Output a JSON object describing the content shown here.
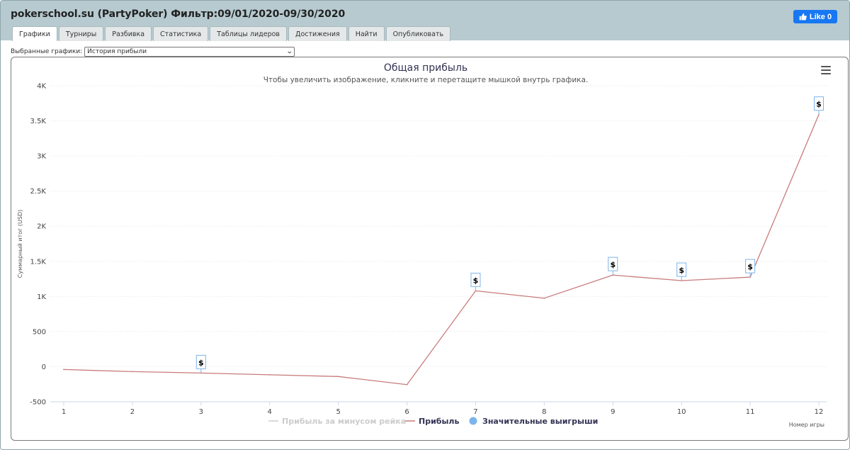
{
  "window": {
    "title": "pokerschool.su (PartyPoker) Фильтр:09/01/2020-09/30/2020",
    "like_label": "Like 0"
  },
  "tabs": [
    {
      "label": "Графики",
      "active": true
    },
    {
      "label": "Турниры",
      "active": false
    },
    {
      "label": "Разбивка",
      "active": false
    },
    {
      "label": "Статистика",
      "active": false
    },
    {
      "label": "Таблицы лидеров",
      "active": false
    },
    {
      "label": "Достижения",
      "active": false
    },
    {
      "label": "Найти",
      "active": false
    },
    {
      "label": "Опубликовать",
      "active": false
    }
  ],
  "selector": {
    "label": "Выбранные графики:",
    "value": "История прибыли"
  },
  "colors": {
    "profit_line": "#c97b7b",
    "rake_line": "#cccccc",
    "flag_border": "#7cb5ec",
    "title": "#333355",
    "like_button": "#1877f2",
    "titlebar": "#b6cad0"
  },
  "chart_data": {
    "type": "line",
    "title": "Общая прибыль",
    "subtitle": "Чтобы увеличить изображение, кликните и перетащите мышкой внутрь графика.",
    "xlabel": "Номер игры",
    "ylabel": "Суммарный итог (USD)",
    "x": [
      1,
      2,
      3,
      4,
      5,
      6,
      7,
      8,
      9,
      10,
      11,
      12
    ],
    "x_ticks": [
      "1",
      "2",
      "3",
      "4",
      "5",
      "6",
      "7",
      "8",
      "9",
      "10",
      "11",
      "12"
    ],
    "ylim": [
      -500,
      4000
    ],
    "y_ticks": [
      "-500",
      "0",
      "500",
      "1K",
      "1.5K",
      "2K",
      "2.5K",
      "3K",
      "3.5K",
      "4K"
    ],
    "y_tick_values": [
      -500,
      0,
      500,
      1000,
      1500,
      2000,
      2500,
      3000,
      3500,
      4000
    ],
    "grid": true,
    "series": [
      {
        "name": "Прибыль за минусом рейка",
        "visible": false,
        "values": []
      },
      {
        "name": "Прибыль",
        "visible": true,
        "values": [
          -40,
          -70,
          -90,
          -115,
          -140,
          -255,
          1080,
          975,
          1305,
          1225,
          1275,
          3590
        ]
      }
    ],
    "flags": {
      "name": "Значительные выигрыши",
      "symbol": "$",
      "x": [
        3,
        7,
        9,
        10,
        11,
        12
      ]
    },
    "legend": [
      {
        "name": "Прибыль за минусом рейка",
        "state": "hidden"
      },
      {
        "name": "Прибыль",
        "state": "visible"
      },
      {
        "name": "Значительные выигрыши",
        "state": "visible"
      }
    ],
    "legend_position": "bottom-center"
  }
}
